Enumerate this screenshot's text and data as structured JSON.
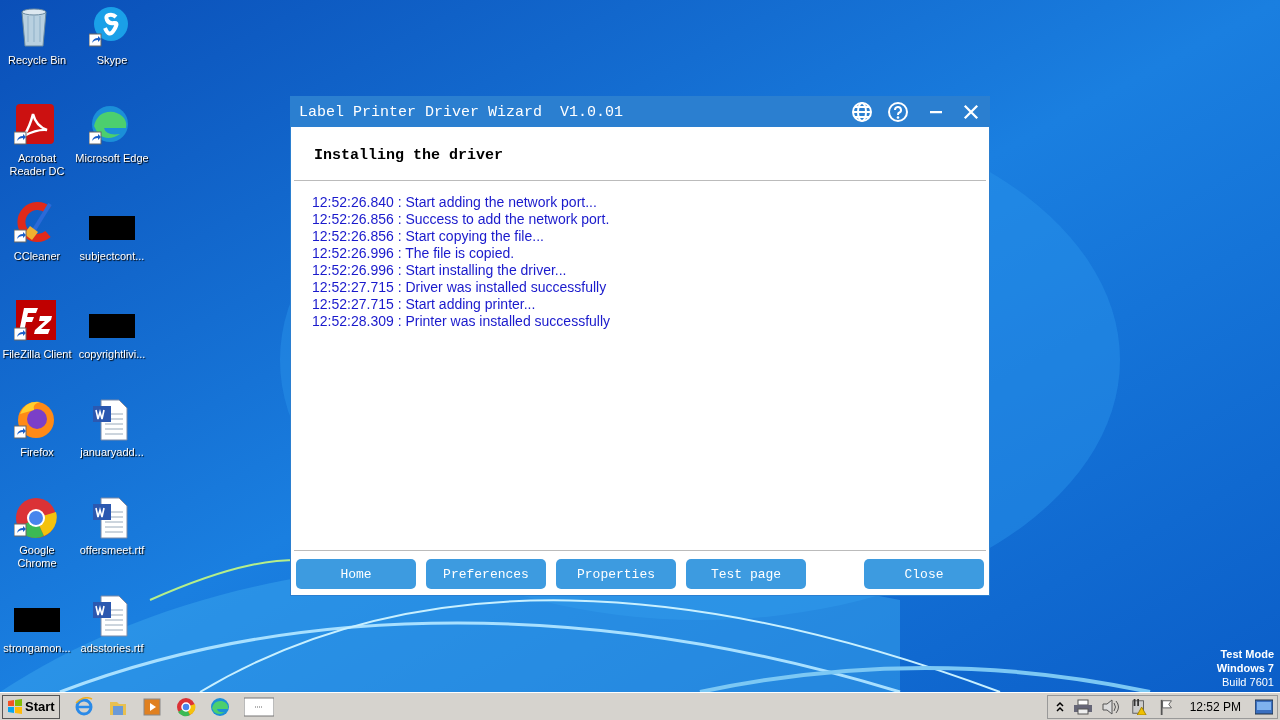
{
  "desktop_icons": [
    {
      "label": "Recycle Bin",
      "kind": "bin",
      "shortcut": false
    },
    {
      "label": "Skype",
      "kind": "skype",
      "shortcut": true
    },
    {
      "label": "Acrobat Reader DC",
      "kind": "acrobat",
      "shortcut": true
    },
    {
      "label": "Microsoft Edge",
      "kind": "edge",
      "shortcut": true
    },
    {
      "label": "CCleaner",
      "kind": "ccleaner",
      "shortcut": true
    },
    {
      "label": "subjectcont...",
      "kind": "redacted",
      "shortcut": false
    },
    {
      "label": "FileZilla Client",
      "kind": "filezilla",
      "shortcut": true
    },
    {
      "label": "copyrightlivi...",
      "kind": "redacted",
      "shortcut": false
    },
    {
      "label": "Firefox",
      "kind": "firefox",
      "shortcut": true
    },
    {
      "label": "januaryadd...",
      "kind": "word",
      "shortcut": false
    },
    {
      "label": "Google Chrome",
      "kind": "chrome",
      "shortcut": true
    },
    {
      "label": "offersmeet.rtf",
      "kind": "word",
      "shortcut": false
    },
    {
      "label": "strongamon...",
      "kind": "redacted",
      "shortcut": false
    },
    {
      "label": "adsstories.rtf",
      "kind": "word",
      "shortcut": false
    }
  ],
  "window": {
    "title": "Label Printer Driver Wizard  V1.0.01",
    "heading": "Installing the driver",
    "log": [
      "12:52:26.840 : Start adding the network port...",
      "12:52:26.856 : Success to add the network port.",
      "12:52:26.856 : Start copying the file...",
      "12:52:26.996 : The file is copied.",
      "12:52:26.996 : Start installing the driver...",
      "12:52:27.715 : Driver was installed successfully",
      "12:52:27.715 : Start adding printer...",
      "12:52:28.309 : Printer was installed successfully"
    ],
    "buttons": [
      "Home",
      "Preferences",
      "Properties",
      "Test page",
      "Close"
    ]
  },
  "watermark_text": [
    "Test Mode",
    "Windows 7",
    "Build 7601"
  ],
  "taskbar": {
    "start": "Start",
    "apps": [
      {
        "kind": "ie"
      },
      {
        "kind": "explorer"
      },
      {
        "kind": "media"
      },
      {
        "kind": "chrome"
      },
      {
        "kind": "edge"
      },
      {
        "kind": "window"
      }
    ],
    "clock": "12:52 PM"
  }
}
